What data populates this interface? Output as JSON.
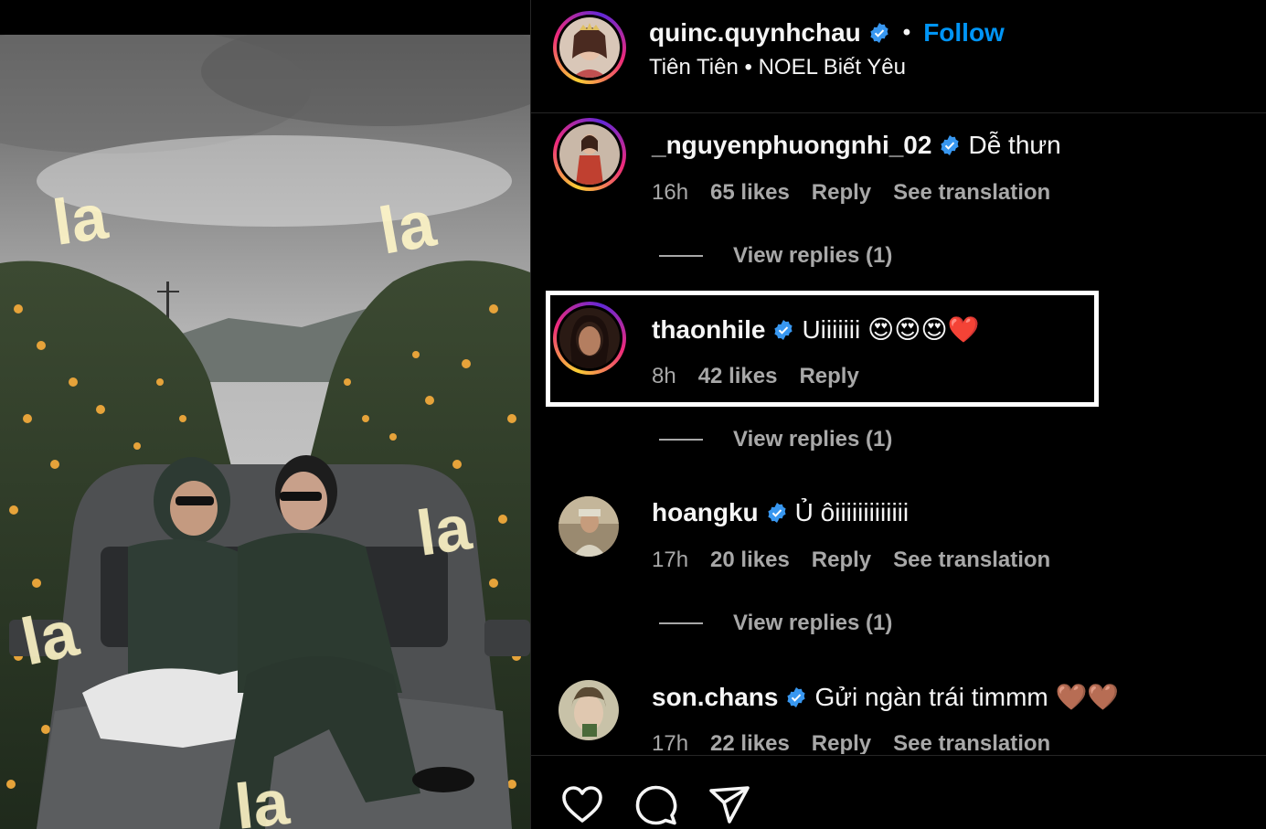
{
  "post": {
    "username": "quinc.quynhchau",
    "follow_label": "Follow",
    "separator": "•",
    "audio": "Tiên Tiên • NOEL Biết Yêu",
    "overlay_words": [
      "la",
      "la",
      "la",
      "la",
      "la",
      "la"
    ]
  },
  "comments": [
    {
      "username": "_nguyenphuongnhi_02",
      "text": "Dễ thưn",
      "time": "16h",
      "likes": "65 likes",
      "reply": "Reply",
      "translate": "See translation",
      "view_replies": "View replies (1)"
    },
    {
      "username": "thaonhile",
      "text": "Uiiiiiii 😍😍😍❤️",
      "time": "8h",
      "likes": "42 likes",
      "reply": "Reply",
      "translate": "",
      "view_replies": "View replies (1)"
    },
    {
      "username": "hoangku",
      "text": "Ủ ôiiiiiiiiiiiii",
      "time": "17h",
      "likes": "20 likes",
      "reply": "Reply",
      "translate": "See translation",
      "view_replies": "View replies (1)"
    },
    {
      "username": "son.chans",
      "text": "Gửi ngàn trái timmm 🤎🤎",
      "time": "17h",
      "likes": "22 likes",
      "reply": "Reply",
      "translate": "See translation",
      "view_replies": ""
    }
  ],
  "actions": {
    "icons": [
      "heart-icon",
      "comment-icon",
      "share-icon"
    ]
  },
  "colors": {
    "follow": "#0095f6",
    "verified": "#3897f0",
    "meta": "#a8a8a8",
    "divider": "#262626"
  }
}
